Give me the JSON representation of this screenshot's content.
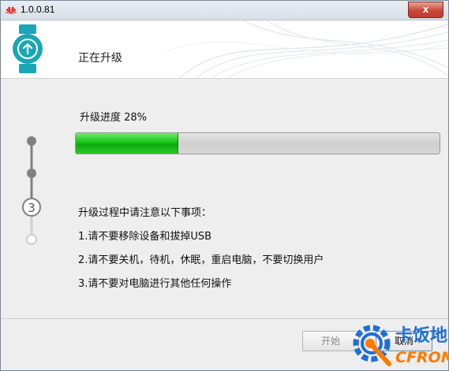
{
  "window": {
    "title": "1.0.0.81",
    "close_label": "x"
  },
  "header": {
    "title": "正在升级"
  },
  "steps": {
    "current_number": "3"
  },
  "progress": {
    "label": "升级进度 28%",
    "percent": 28,
    "fill_color": "#16c316"
  },
  "notes": {
    "heading": "升级过程中请注意以下事项：",
    "items": [
      "1.请不要移除设备和拔掉USB",
      "2.请不要关机，待机，休眠，重启电脑，不要切换用户",
      "3.请不要对电脑进行其他任何操作"
    ]
  },
  "footer": {
    "start_label": "开始",
    "cancel_label": "取消"
  },
  "watermark": {
    "cn_text": "卡饭地",
    "en_text": "CFROM"
  },
  "colors": {
    "accent_teal": "#1aa6b7",
    "brand_red": "#e1231e",
    "watermark_blue": "#1f6fd6",
    "watermark_orange": "#ff7a00"
  }
}
